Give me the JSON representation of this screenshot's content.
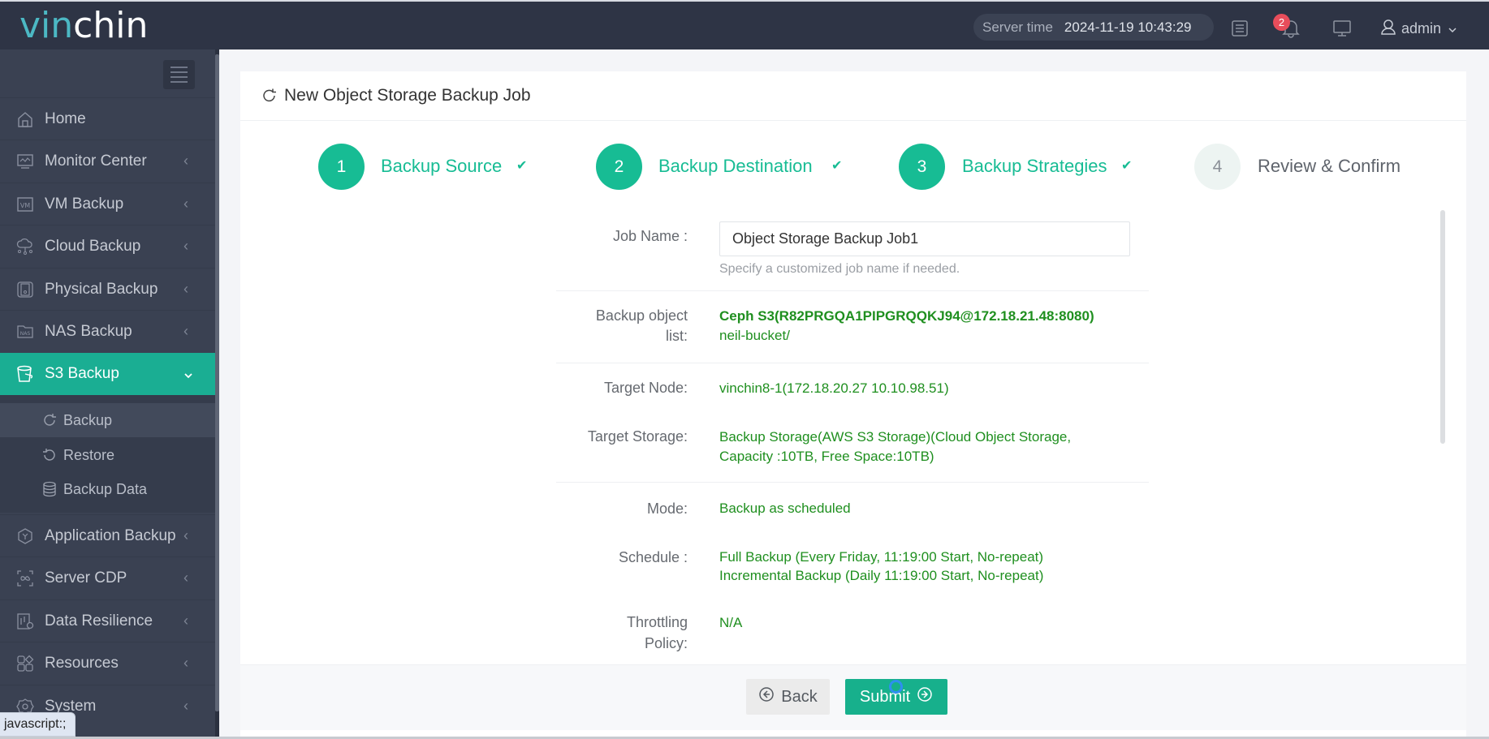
{
  "header": {
    "logo_part1": "vin",
    "logo_part2": "chin",
    "server_time_label": "Server time",
    "server_time_value": "2024-11-19 10:43:29",
    "notification_count": "2",
    "user_name": "admin",
    "icons": [
      "list-icon",
      "bell-icon",
      "monitor-icon",
      "user-icon",
      "chevron-down-icon"
    ]
  },
  "sidebar": {
    "items": [
      {
        "label": "Home",
        "icon": "home-icon"
      },
      {
        "label": "Monitor Center",
        "icon": "monitor-center-icon",
        "chevron": "‹"
      },
      {
        "label": "VM Backup",
        "icon": "vm-icon",
        "chevron": "‹"
      },
      {
        "label": "Cloud Backup",
        "icon": "cloud-icon",
        "chevron": "‹"
      },
      {
        "label": "Physical Backup",
        "icon": "physical-server-icon",
        "chevron": "‹"
      },
      {
        "label": "NAS Backup",
        "icon": "nas-icon",
        "chevron": "‹"
      },
      {
        "label": "S3 Backup",
        "icon": "bucket-icon",
        "chevron": "⌄",
        "active": true
      },
      {
        "label": "Application Backup",
        "icon": "application-icon",
        "chevron": "‹"
      },
      {
        "label": "Server CDP",
        "icon": "cdp-icon",
        "chevron": "‹"
      },
      {
        "label": "Data Resilience",
        "icon": "data-resilience-icon",
        "chevron": "‹"
      },
      {
        "label": "Resources",
        "icon": "resources-icon",
        "chevron": "‹"
      },
      {
        "label": "System",
        "icon": "gear-icon",
        "chevron": "‹"
      }
    ],
    "sub_items": [
      {
        "label": "Backup",
        "icon": "refresh-icon",
        "selected": true
      },
      {
        "label": "Restore",
        "icon": "restore-icon"
      },
      {
        "label": "Backup Data",
        "icon": "database-icon"
      }
    ]
  },
  "page": {
    "title": "New Object Storage Backup Job",
    "steps": [
      {
        "number": "1",
        "label": "Backup Source",
        "done": true,
        "check": "✔"
      },
      {
        "number": "2",
        "label": "Backup Destination",
        "done": true,
        "check": "✔"
      },
      {
        "number": "3",
        "label": "Backup Strategies",
        "done": true,
        "check": "✔"
      },
      {
        "number": "4",
        "label": "Review & Confirm",
        "done": false
      }
    ],
    "form": {
      "job_name_label": "Job Name :",
      "job_name_value": "Object Storage Backup Job1",
      "job_name_hint": "Specify a customized job name if needed.",
      "backup_object_label_line1": "Backup object",
      "backup_object_label_line2": "list:",
      "backup_object_source": "Ceph S3(R82PRGQA1PIPGRQQKJ94@172.18.21.48:8080)",
      "backup_object_bucket": "neil-bucket/",
      "target_node_label": "Target Node:",
      "target_node_value": "vinchin8-1(172.18.20.27 10.10.98.51)",
      "target_storage_label": "Target Storage:",
      "target_storage_line1": "Backup Storage(AWS S3 Storage)(Cloud Object Storage,",
      "target_storage_line2": "Capacity :10TB, Free Space:10TB)",
      "mode_label": "Mode:",
      "mode_value": "Backup as scheduled",
      "schedule_label": "Schedule :",
      "schedule_full": "Full Backup (Every Friday, 11:19:00 Start, No-repeat)",
      "schedule_incremental": "Incremental Backup (Daily 11:19:00 Start, No-repeat)",
      "throttling_label_line1": "Throttling",
      "throttling_label_line2": "Policy:",
      "throttling_value": "N/A"
    },
    "actions": {
      "back_label": "Back",
      "submit_label": "Submit"
    }
  },
  "status_bar": {
    "link_preview": "javascript:;"
  },
  "colors": {
    "accent": "#17bc94",
    "header_bg": "#2e3445",
    "sidebar_bg": "#3a4152",
    "sidebar_active": "#1aae93",
    "value_green": "#1f8f1f",
    "badge_red": "#e84d5b"
  }
}
